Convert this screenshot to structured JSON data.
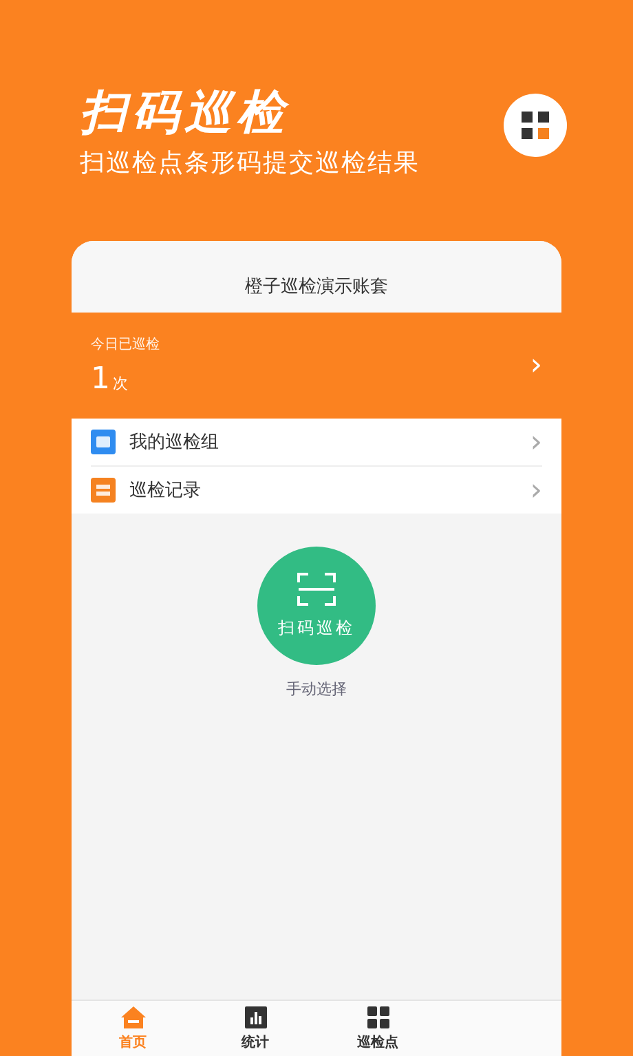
{
  "header": {
    "title": "扫码巡检",
    "subtitle": "扫巡检点条形码提交巡检结果"
  },
  "account": {
    "name": "橙子巡检演示账套"
  },
  "today": {
    "label": "今日已巡检",
    "count": "1",
    "unit": "次",
    "chevron": "›"
  },
  "menu": [
    {
      "kind": "group",
      "label": "我的巡检组",
      "chevron": "›"
    },
    {
      "kind": "record",
      "label": "巡检记录",
      "chevron": "›"
    }
  ],
  "scan": {
    "label": "扫码巡检",
    "manual": "手动选择"
  },
  "tabs": [
    {
      "kind": "home",
      "label": "首页",
      "selected": true
    },
    {
      "kind": "stats",
      "label": "统计",
      "selected": false
    },
    {
      "kind": "points",
      "label": "巡检点",
      "selected": false
    }
  ]
}
